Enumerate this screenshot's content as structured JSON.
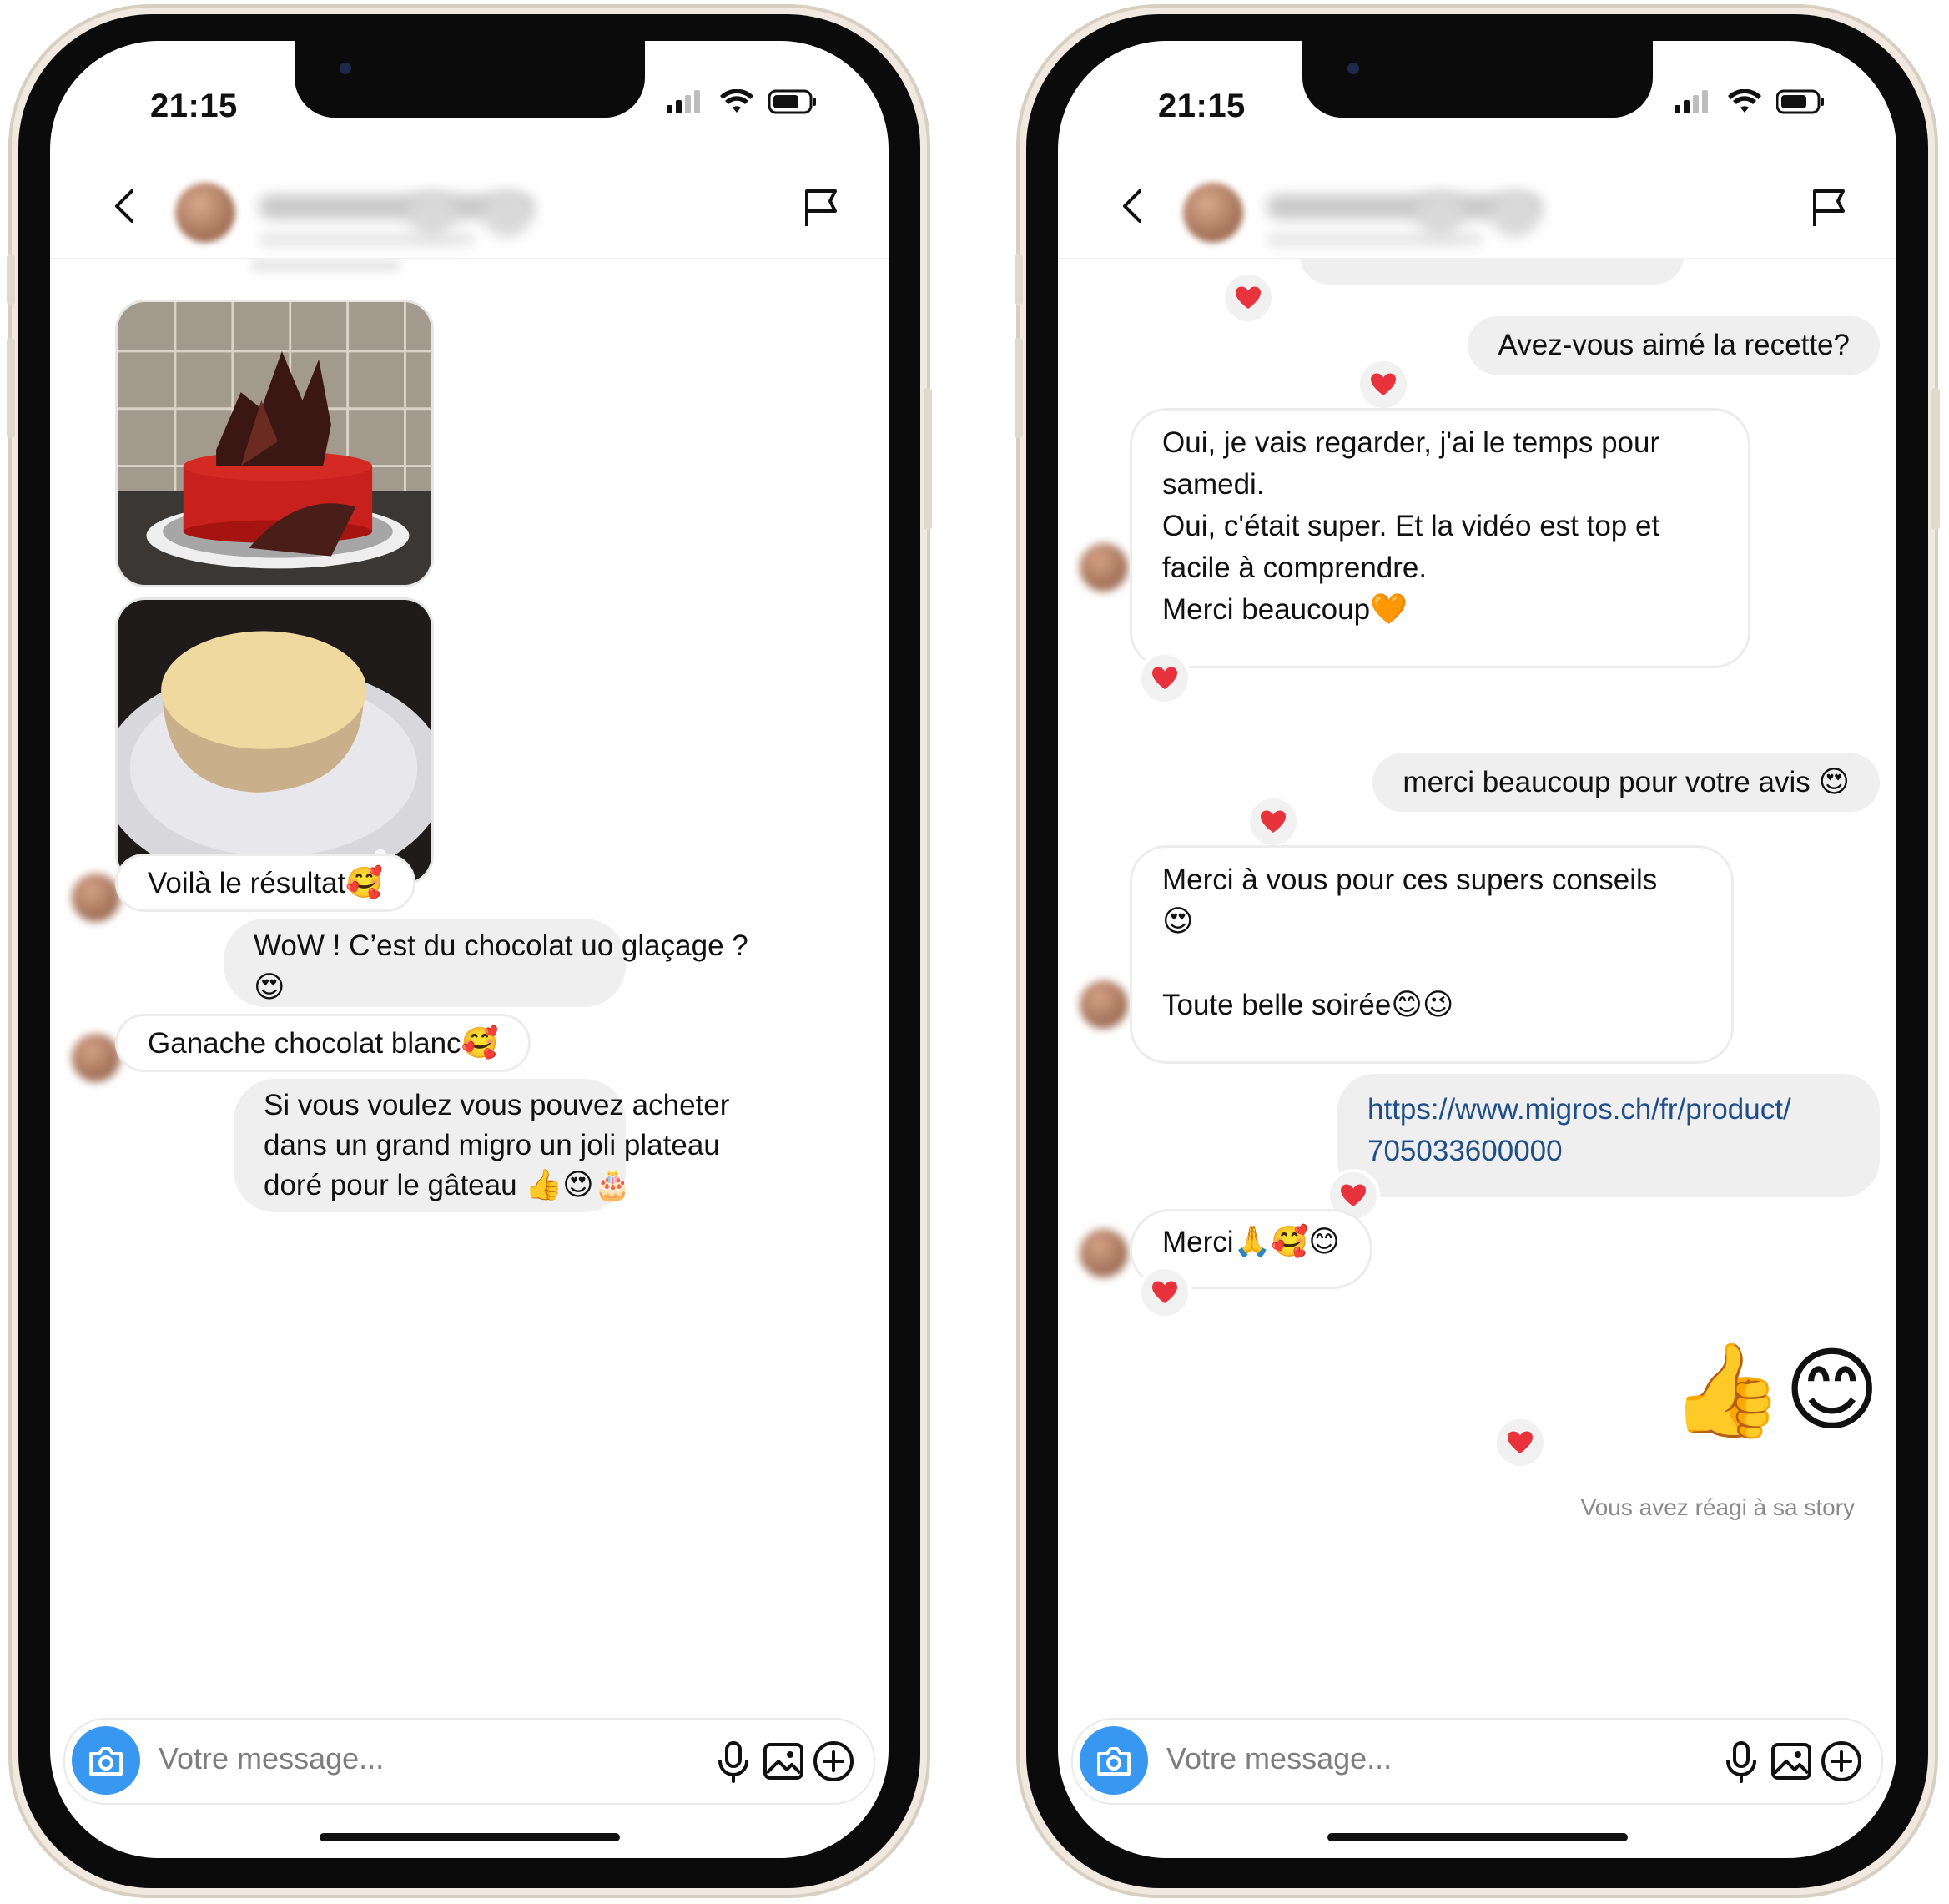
{
  "status_bar": {
    "time": "21:15"
  },
  "composer": {
    "placeholder": "Votre message..."
  },
  "left": {
    "messages": [
      {
        "id": "l1",
        "text": "Voilà le résultat",
        "emoji": "🥰"
      },
      {
        "id": "l2",
        "lines": [
          "WoW ! C’est du chocolat uo glaçage ?",
          "😍"
        ]
      },
      {
        "id": "l3",
        "text": "Ganache chocolat blanc",
        "emoji": "🥰"
      },
      {
        "id": "l4",
        "lines": [
          "Si vous voulez vous pouvez acheter",
          "dans un grand migro un joli plateau",
          "doré pour le gâteau"
        ],
        "emoji": "👍😍🎂"
      }
    ]
  },
  "right": {
    "messages": [
      {
        "id": "r1",
        "text": "Avez-vous aimé la recette?"
      },
      {
        "id": "r2",
        "lines": [
          "Oui, je vais regarder, j'ai le temps pour",
          "samedi.",
          "Oui, c'était super. Et la vidéo est top et",
          "facile à comprendre.",
          "Merci beaucoup"
        ],
        "emoji": "🧡"
      },
      {
        "id": "r3",
        "text": "merci beaucoup pour votre avis",
        "emoji": "😍"
      },
      {
        "id": "r4",
        "lines": [
          "Merci à vous pour ces supers conseils",
          "😍",
          "",
          "Toute belle soirée"
        ],
        "emoji": "😊😉"
      },
      {
        "id": "r5",
        "lines": [
          "https://www.migros.ch/fr/product/",
          "705033600000"
        ]
      },
      {
        "id": "r6",
        "text": "Merci",
        "emoji": "🙏🥰😊"
      },
      {
        "id": "r7",
        "emoji": "👍😊"
      }
    ],
    "story_note": "Vous avez réagi à sa story"
  },
  "colors": {
    "accent": "#3897f0",
    "heart": "#e8323c",
    "link": "#1e4f8a"
  },
  "icons": [
    "back-icon",
    "flag-icon",
    "camera-icon",
    "microphone-icon",
    "image-icon",
    "plus-icon",
    "heart-icon",
    "signal-icon",
    "wifi-icon",
    "battery-icon"
  ]
}
